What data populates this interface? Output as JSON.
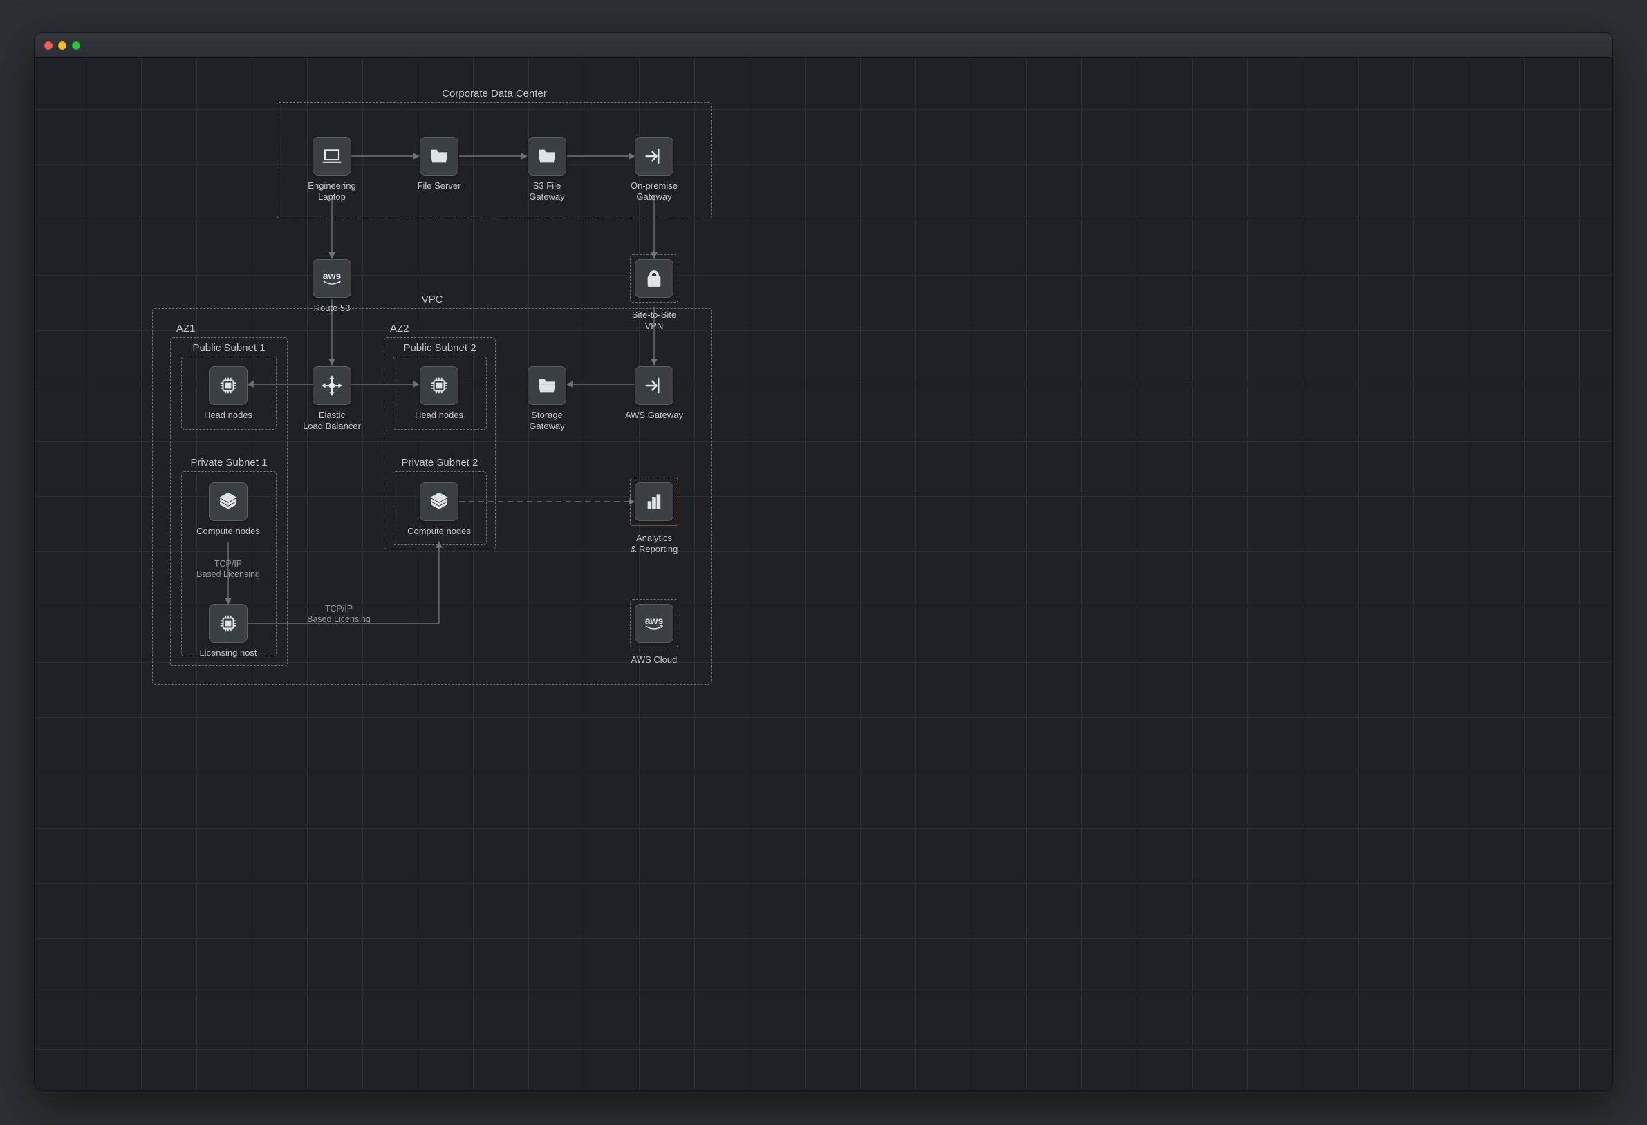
{
  "frames": {
    "corporate_dc": {
      "label": "Corporate Data Center"
    },
    "vpc": {
      "label": "VPC"
    },
    "az1": {
      "label": "AZ1"
    },
    "az2": {
      "label": "AZ2"
    },
    "pub_subnet_1": {
      "label": "Public Subnet 1"
    },
    "pub_subnet_2": {
      "label": "Public Subnet 2"
    },
    "priv_subnet_1": {
      "label": "Private Subnet 1"
    },
    "priv_subnet_2": {
      "label": "Private Subnet 2"
    }
  },
  "nodes": {
    "eng_laptop": {
      "label": "Engineering\nLaptop",
      "icon": "laptop"
    },
    "file_server": {
      "label": "File Server",
      "icon": "folder"
    },
    "s3_file_gateway": {
      "label": "S3 File\nGateway",
      "icon": "folder"
    },
    "onprem_gateway": {
      "label": "On-premise\nGateway",
      "icon": "arrow-in"
    },
    "route53": {
      "label": "Route 53",
      "icon": "aws"
    },
    "site_vpn": {
      "label": "Site-to-Site\nVPN",
      "icon": "lock"
    },
    "head_nodes_1": {
      "label": "Head nodes",
      "icon": "chip"
    },
    "head_nodes_2": {
      "label": "Head nodes",
      "icon": "chip"
    },
    "elb": {
      "label": "Elastic\nLoad Balancer",
      "icon": "load-balancer"
    },
    "storage_gateway": {
      "label": "Storage\nGateway",
      "icon": "folder"
    },
    "aws_gateway": {
      "label": "AWS Gateway",
      "icon": "arrow-in"
    },
    "compute_1": {
      "label": "Compute nodes",
      "icon": "layers"
    },
    "compute_2": {
      "label": "Compute nodes",
      "icon": "layers"
    },
    "analytics": {
      "label": "Analytics\n& Reporting",
      "icon": "bar-chart"
    },
    "licensing_host": {
      "label": "Licensing host",
      "icon": "chip"
    },
    "aws_cloud": {
      "label": "AWS Cloud",
      "icon": "aws"
    }
  },
  "edge_labels": {
    "tcp_lic_1": "TCP/IP\nBased Licensing",
    "tcp_lic_2": "TCP/IP\nBased Licensing"
  }
}
